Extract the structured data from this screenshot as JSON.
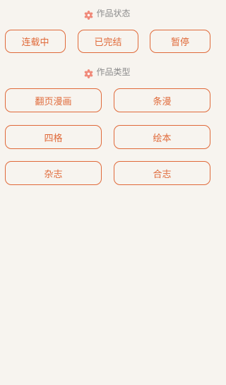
{
  "status_section": {
    "title": "作品状态",
    "options": [
      "连载中",
      "已完结",
      "暂停"
    ]
  },
  "type_section": {
    "title": "作品类型",
    "options": [
      "翻页漫画",
      "条漫",
      "四格",
      "绘本",
      "杂志",
      "合志"
    ]
  },
  "colors": {
    "accent": "#e06a3a",
    "icon": "#f08a7a",
    "background": "#f7f4ef",
    "header_text": "#8c8c8c"
  }
}
